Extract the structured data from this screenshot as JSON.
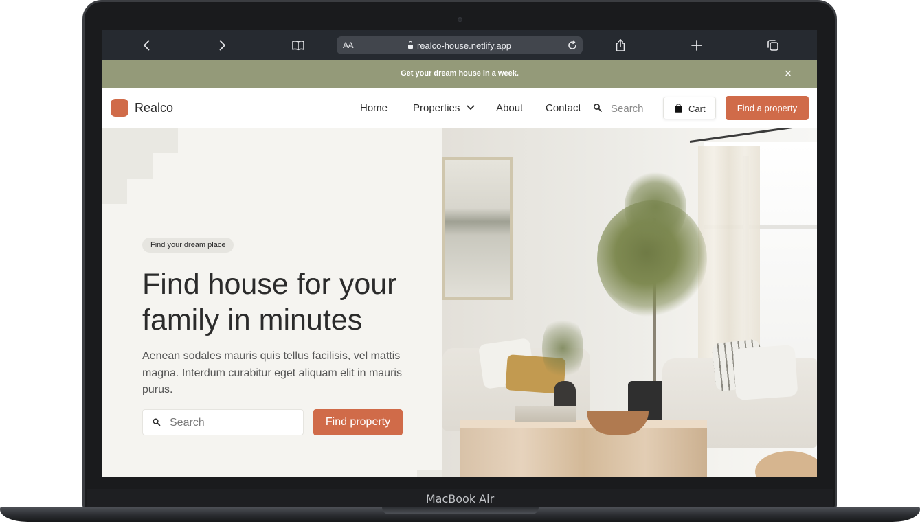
{
  "device": {
    "label": "MacBook Air"
  },
  "browser": {
    "text_size": "AA",
    "url": "realco-house.netlify.app",
    "icons": [
      "chevron-left-icon",
      "chevron-right-icon",
      "book-icon",
      "share-icon",
      "plus-icon",
      "tabs-icon",
      "reload-icon",
      "lock-icon"
    ]
  },
  "banner": {
    "text": "Get your dream house in a week.",
    "close_icon": "close-icon"
  },
  "nav": {
    "logo": "Realco",
    "links": [
      "Home",
      "Properties",
      "About",
      "Contact"
    ],
    "search_placeholder": "Search",
    "cart_label": "Cart",
    "cta_label": "Find a property"
  },
  "hero": {
    "tag": "Find your dream place",
    "headline": "Find house for your family in minutes",
    "subtext": "Aenean sodales mauris quis tellus facilisis, vel mattis magna. Interdum curabitur eget aliquam elit in mauris purus.",
    "search_placeholder": "Search",
    "button_label": "Find property"
  },
  "colors": {
    "accent": "#d06b49",
    "banner": "#949a79",
    "toolbar": "#262a30",
    "text": "#2b2b2b"
  }
}
